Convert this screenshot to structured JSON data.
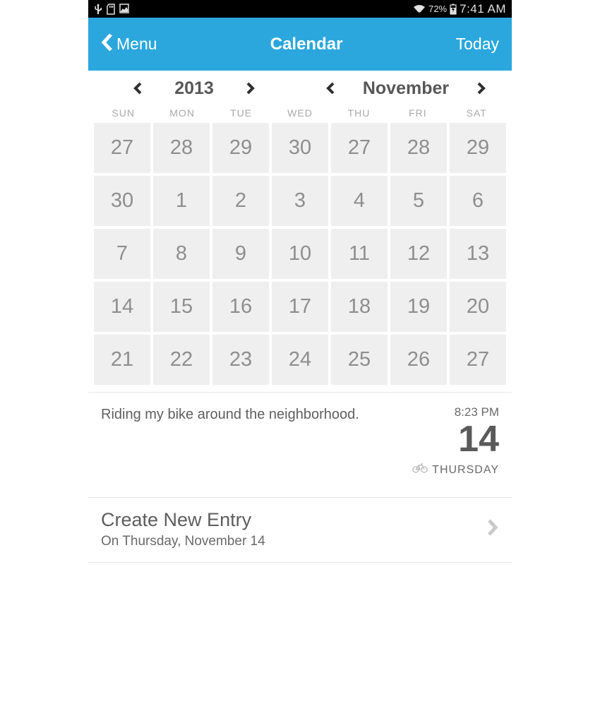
{
  "statusbar": {
    "battery_pct": "72%",
    "time": "7:41 AM"
  },
  "topnav": {
    "menu_label": "Menu",
    "title": "Calendar",
    "today_label": "Today"
  },
  "selector": {
    "year": "2013",
    "month": "November"
  },
  "weekdays": [
    "SUN",
    "MON",
    "TUE",
    "WED",
    "THU",
    "FRI",
    "SAT"
  ],
  "days": [
    "27",
    "28",
    "29",
    "30",
    "27",
    "28",
    "29",
    "30",
    "1",
    "2",
    "3",
    "4",
    "5",
    "6",
    "7",
    "8",
    "9",
    "10",
    "11",
    "12",
    "13",
    "14",
    "15",
    "16",
    "17",
    "18",
    "19",
    "20",
    "21",
    "22",
    "23",
    "24",
    "25",
    "26",
    "27"
  ],
  "entry": {
    "text": "Riding my bike around the neighborhood.",
    "time": "8:23 PM",
    "daynum": "14",
    "dow": "THURSDAY"
  },
  "create": {
    "title": "Create New Entry",
    "subtitle": "On Thursday, November 14"
  }
}
